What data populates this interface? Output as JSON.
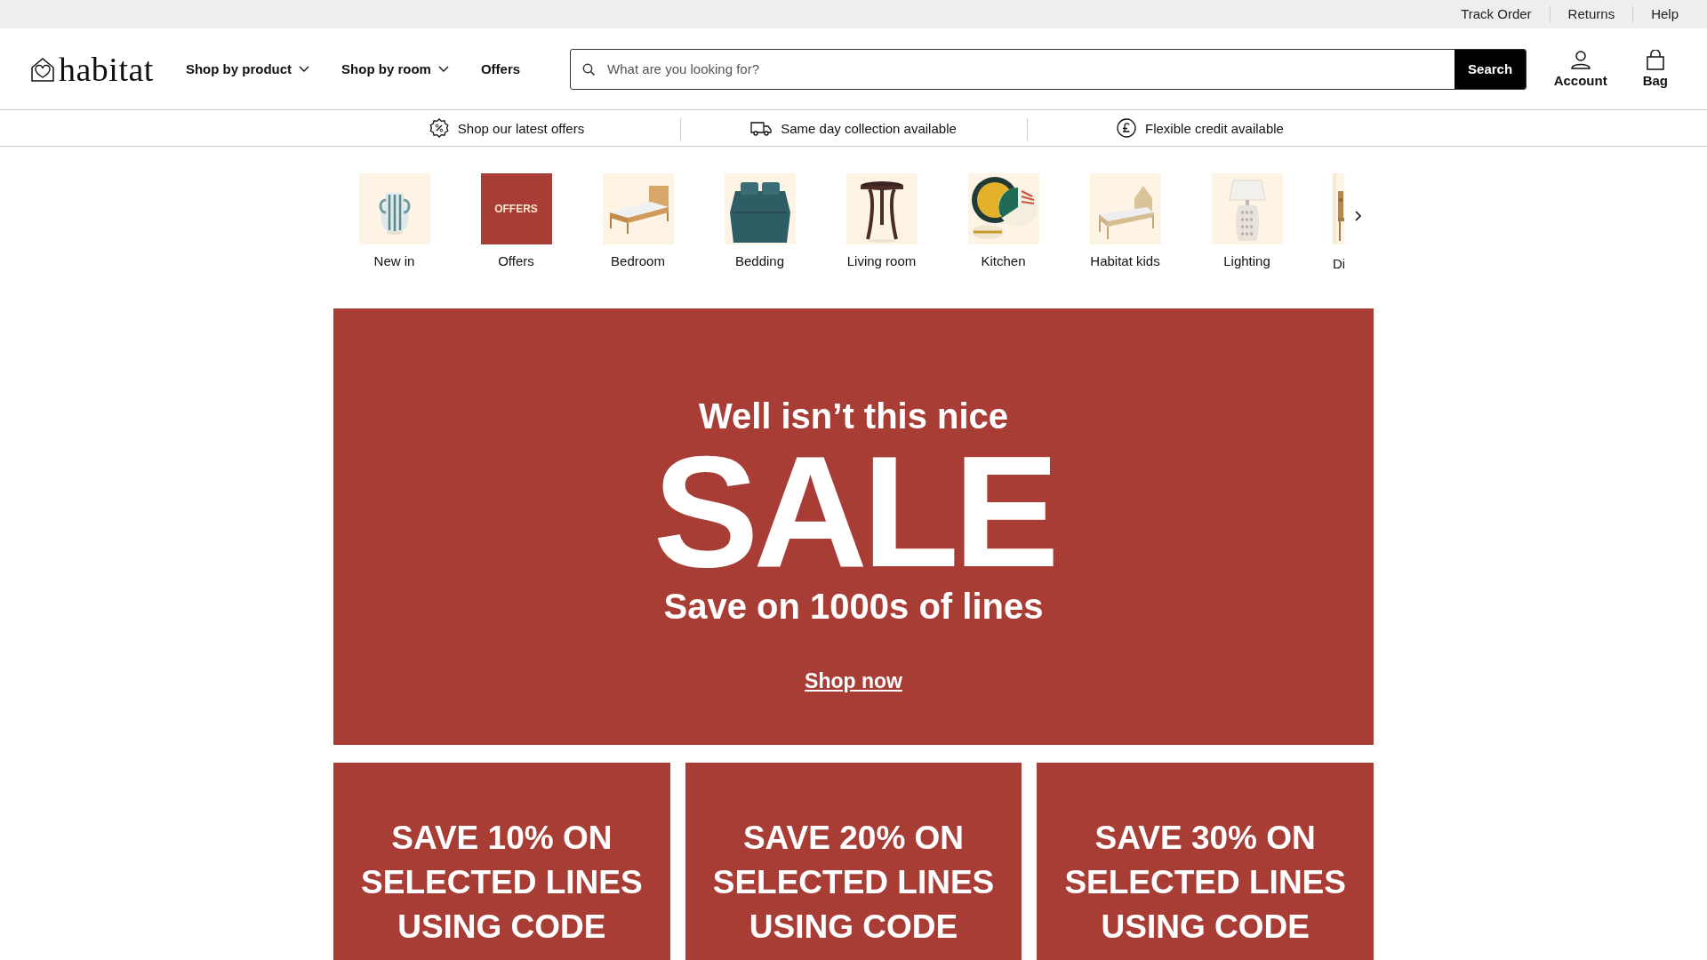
{
  "top_links": [
    "Track Order",
    "Returns",
    "Help"
  ],
  "logo": {
    "text": "habitat"
  },
  "nav": [
    {
      "label": "Shop by product",
      "dropdown": true
    },
    {
      "label": "Shop by room",
      "dropdown": true
    },
    {
      "label": "Offers",
      "dropdown": false
    }
  ],
  "search": {
    "placeholder": "What are you looking for?",
    "button": "Search"
  },
  "account_links": [
    {
      "label": "Account",
      "kind": "account"
    },
    {
      "label": "Bag",
      "kind": "bag"
    }
  ],
  "benefits": [
    {
      "text": "Shop our latest offers",
      "kind": "offers"
    },
    {
      "text": "Same day collection available",
      "kind": "delivery"
    },
    {
      "text": "Flexible credit available",
      "kind": "credit"
    }
  ],
  "categories": [
    {
      "label": "New in",
      "kind": "picture"
    },
    {
      "label": "Offers",
      "kind": "tile",
      "tile_text": "OFFERS"
    },
    {
      "label": "Bedroom",
      "kind": "picture"
    },
    {
      "label": "Bedding",
      "kind": "picture"
    },
    {
      "label": "Living room",
      "kind": "picture"
    },
    {
      "label": "Kitchen",
      "kind": "picture"
    },
    {
      "label": "Habitat kids",
      "kind": "picture"
    },
    {
      "label": "Lighting",
      "kind": "picture"
    },
    {
      "label": "Di",
      "kind": "picture"
    }
  ],
  "hero": {
    "kicker": "Well isn’t this nice",
    "headline": "SALE",
    "subline": "Save on 1000s of lines",
    "link": "Shop now"
  },
  "promo_cards": [
    {
      "text": "SAVE 10% ON SELECTED LINES USING CODE"
    },
    {
      "text": "SAVE 20% ON SELECTED LINES USING CODE"
    },
    {
      "text": "SAVE 30% ON SELECTED LINES USING CODE"
    }
  ]
}
